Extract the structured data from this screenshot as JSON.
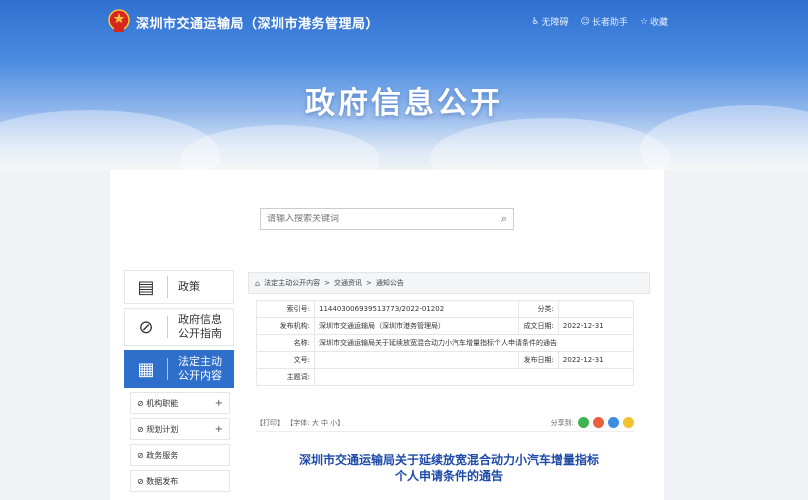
{
  "header": {
    "site_title": "深圳市交通运输局（深圳市港务管理局）",
    "links": [
      {
        "icon": "accessibility-icon",
        "label": "无障碍"
      },
      {
        "icon": "elder-mode-icon",
        "label": "长者助手"
      },
      {
        "icon": "collect-icon",
        "label": "收藏"
      }
    ],
    "hero_title": "政府信息公开"
  },
  "search": {
    "placeholder": "请输入搜索关键词"
  },
  "sidebar": {
    "cards": [
      {
        "icon": "policy-icon",
        "label": "政策"
      },
      {
        "icon": "compass-icon",
        "label_line1": "政府信息",
        "label_line2": "公开指南"
      },
      {
        "icon": "document-icon",
        "label_line1": "法定主动",
        "label_line2": "公开内容"
      }
    ],
    "sub_items": [
      "机构职能",
      "规划计划",
      "政务服务",
      "数据发布"
    ]
  },
  "breadcrumb": [
    "法定主动公开内容",
    "交通资讯",
    "通知公告"
  ],
  "info": {
    "index_label": "索引号:",
    "index_value": "11440300693951377З/2022-01202",
    "category_label": "分类:",
    "category_value": "",
    "publisher_label": "发布机构:",
    "publisher_value": "深圳市交通运输局（深圳市港务管理局）",
    "date_made_label": "成文日期:",
    "date_made_value": "2022-12-31",
    "name_label": "名称:",
    "name_value": "深圳市交通运输局关于延续放宽混合动力小汽车增量指标个人申请条件的通告",
    "doc_no_label": "文号:",
    "doc_no_value": "",
    "pub_date_label": "发布日期:",
    "pub_date_value": "2022-12-31",
    "subject_label": "主题词:",
    "subject_value": ""
  },
  "tools": {
    "print": "【打印】",
    "font": "【字体: 大  中  小】",
    "share_label": "分享到:"
  },
  "article": {
    "title_line1": "深圳市交通运输局关于延续放宽混合动力小汽车增量指标",
    "title_line2": "个人申请条件的通告"
  }
}
